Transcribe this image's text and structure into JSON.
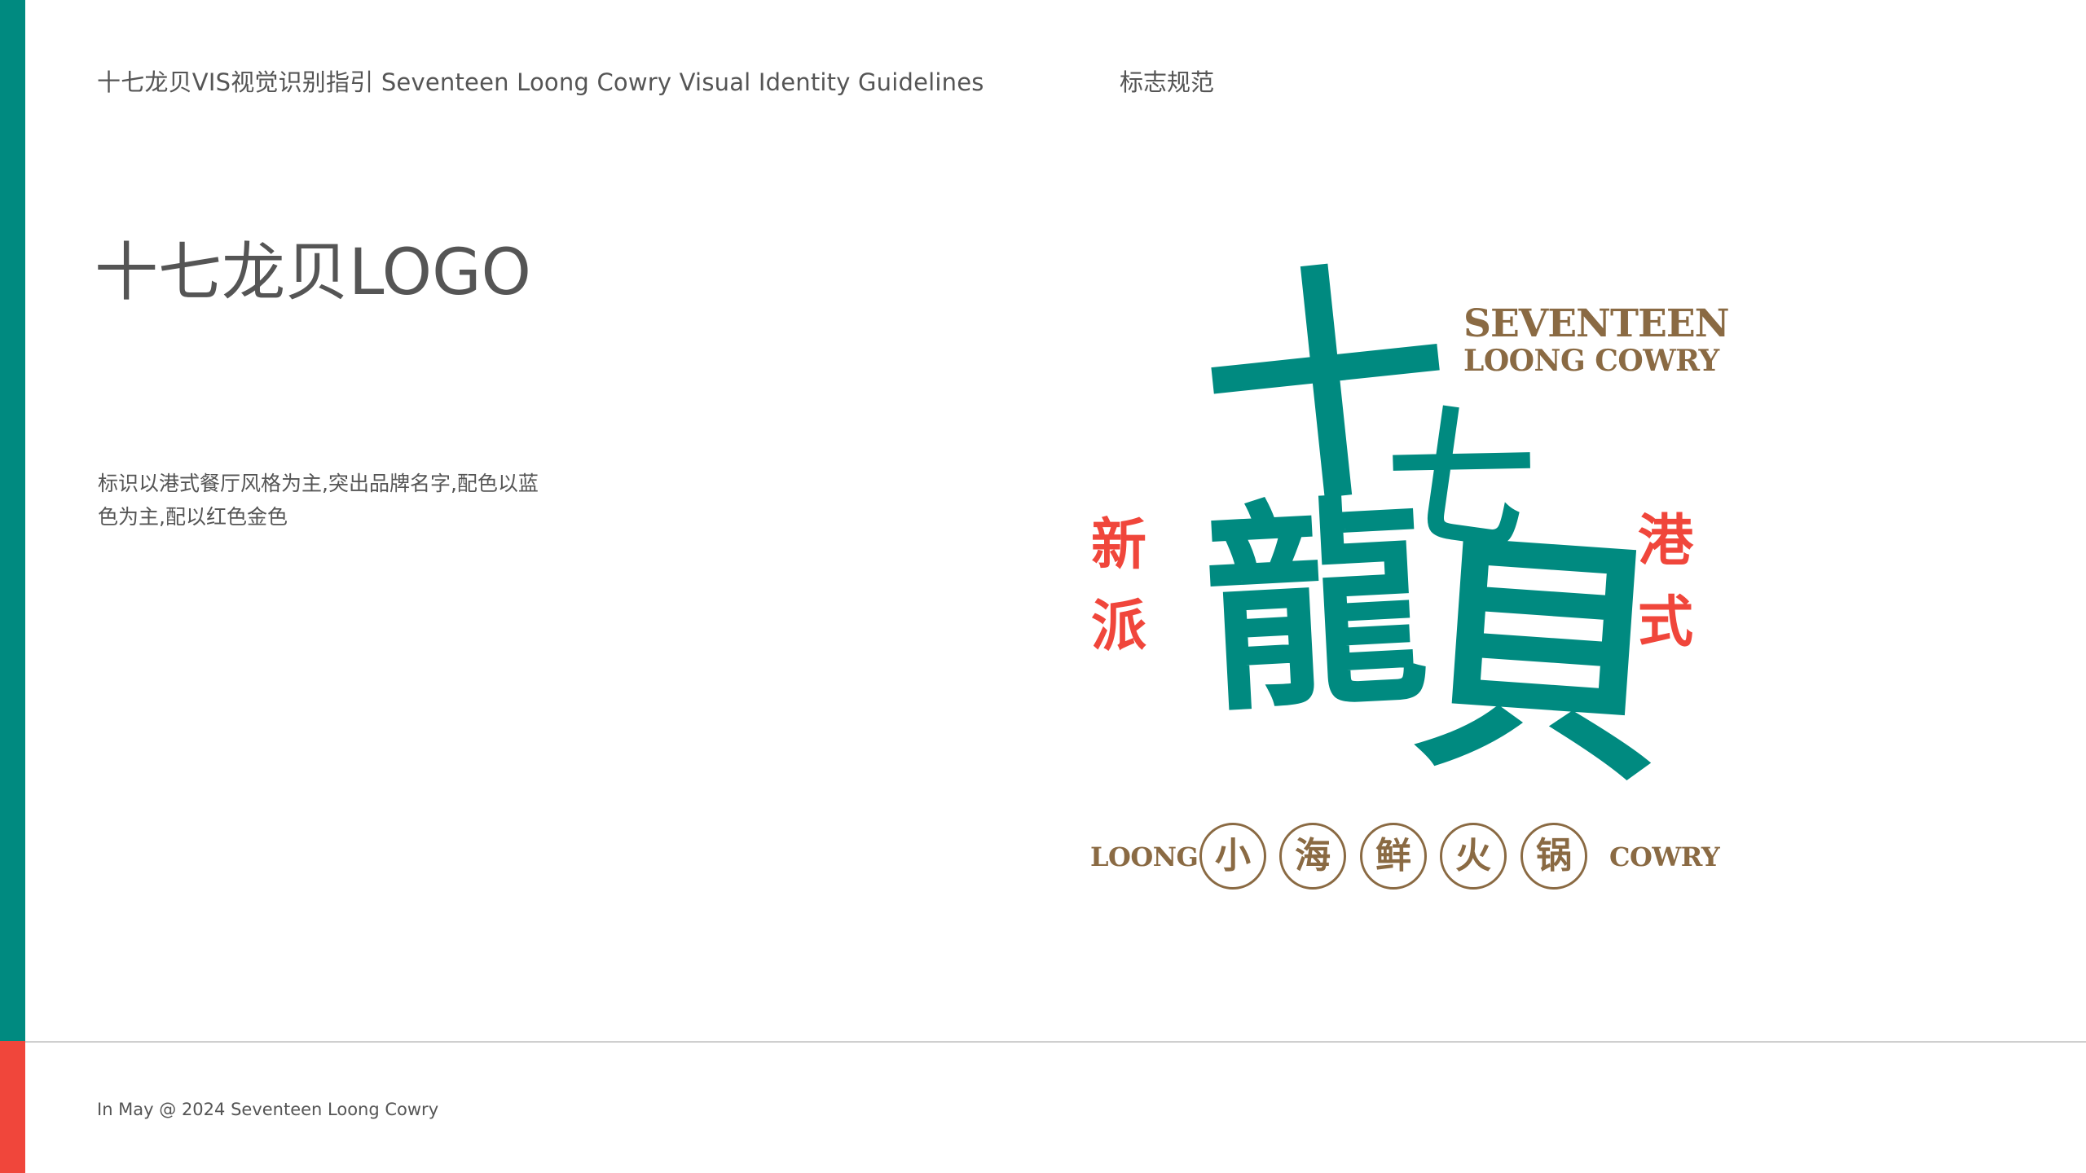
{
  "header": {
    "title": "十七龙贝VIS视觉识别指引 Seventeen Loong Cowry Visual Identity Guidelines",
    "section": "标志规范"
  },
  "main": {
    "title": "十七龙贝LOGO",
    "description": "标识以港式餐厅风格为主,突出品牌名字,配色以蓝色为主,配以红色金色"
  },
  "logo": {
    "chars": [
      "十",
      "七",
      "龍",
      "貝"
    ],
    "english_line1": "SEVENTEEN",
    "english_line2": "LOONG COWRY",
    "left_chars": [
      "新",
      "派"
    ],
    "right_chars": [
      "港",
      "式"
    ],
    "tag_left": "LOONG",
    "tag_right": "COWRY",
    "tag_chars": [
      "小",
      "海",
      "鲜",
      "火",
      "锅"
    ],
    "colors": {
      "primary": "#008a80",
      "accent": "#f0463b",
      "gold": "#8a6a43"
    }
  },
  "footer": {
    "text": "In May @ 2024 Seventeen Loong Cowry"
  },
  "colors": {
    "side_bar_top": "#008a80",
    "side_bar_bottom": "#f0463b",
    "text": "#555555"
  }
}
